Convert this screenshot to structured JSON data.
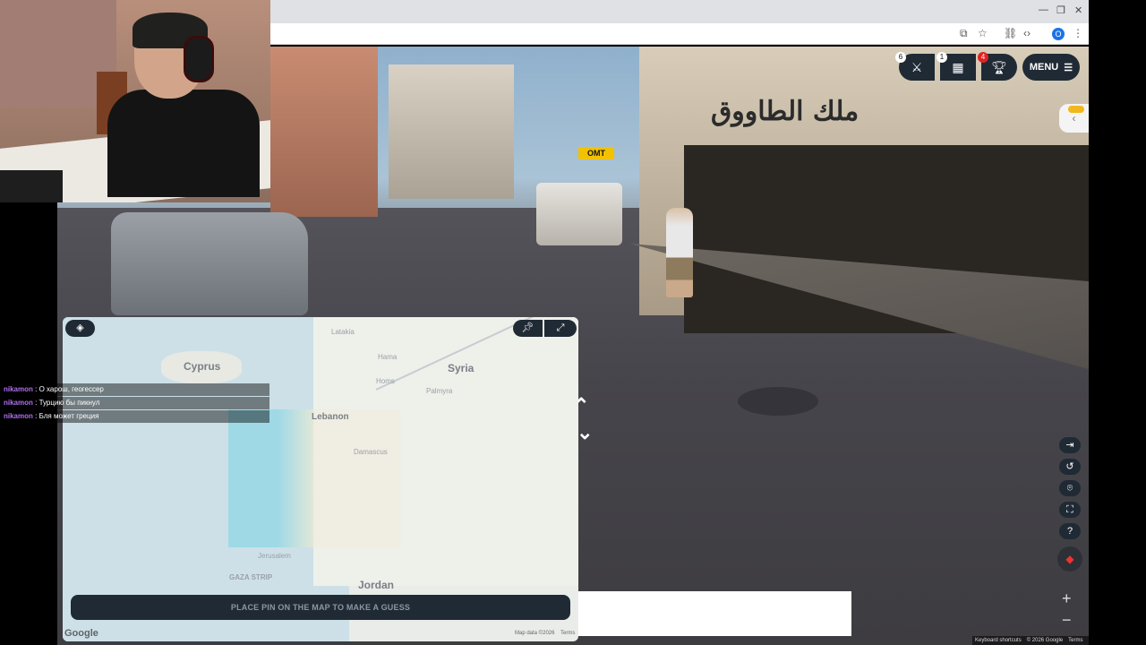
{
  "browser": {
    "window_controls": {
      "minimize": "—",
      "restore": "❐",
      "close": "✕"
    },
    "profile_initial": "O"
  },
  "hud": {
    "duel_badge": "6",
    "party_badge": "1",
    "trophy_badge": "4",
    "menu_label": "MENU"
  },
  "street": {
    "shop_sign": "ملك الطاووق",
    "omt_sign": "OMT"
  },
  "map": {
    "labels": {
      "cyprus": "Cyprus",
      "syria": "Syria",
      "lebanon": "Lebanon",
      "jordan": "Jordan",
      "damascus": "Damascus",
      "homs": "Homs",
      "hama": "Hama",
      "latakia": "Latakia",
      "jerusalem": "Jerusalem",
      "gaza": "GAZA STRIP",
      "palmyra": "Palmyra"
    },
    "guess_button": "PLACE PIN ON THE MAP TO MAKE A GUESS",
    "google_logo": "Google",
    "attribution": "Map data ©2026",
    "terms": "Terms"
  },
  "footer": {
    "shortcuts": "Keyboard shortcuts",
    "copyright": "© 2026 Google",
    "terms": "Terms"
  },
  "chat": [
    {
      "user": "nikamon",
      "message": " : О харош, геогессер"
    },
    {
      "user": "nikamon",
      "message": " : Турцию бы пикнул"
    },
    {
      "user": "nikamon",
      "message": " : Бля может греция"
    }
  ]
}
